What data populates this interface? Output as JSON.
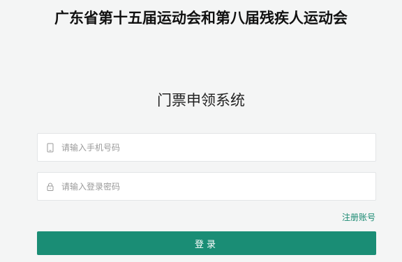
{
  "header": {
    "event_title": "广东省第十五届运动会和第八届残疾人运动会"
  },
  "login_form": {
    "title": "门票申领系统",
    "phone": {
      "placeholder": "请输入手机号码",
      "value": "",
      "icon": "phone-icon"
    },
    "password": {
      "placeholder": "请输入登录密码",
      "value": "",
      "icon": "lock-icon"
    },
    "register_label": "注册账号",
    "login_label": "登录"
  },
  "colors": {
    "background": "#f4f5f5",
    "accent": "#1a8d75",
    "link": "#1a8a72",
    "input_border": "#e3e5e7",
    "placeholder": "#9a9a9a"
  }
}
